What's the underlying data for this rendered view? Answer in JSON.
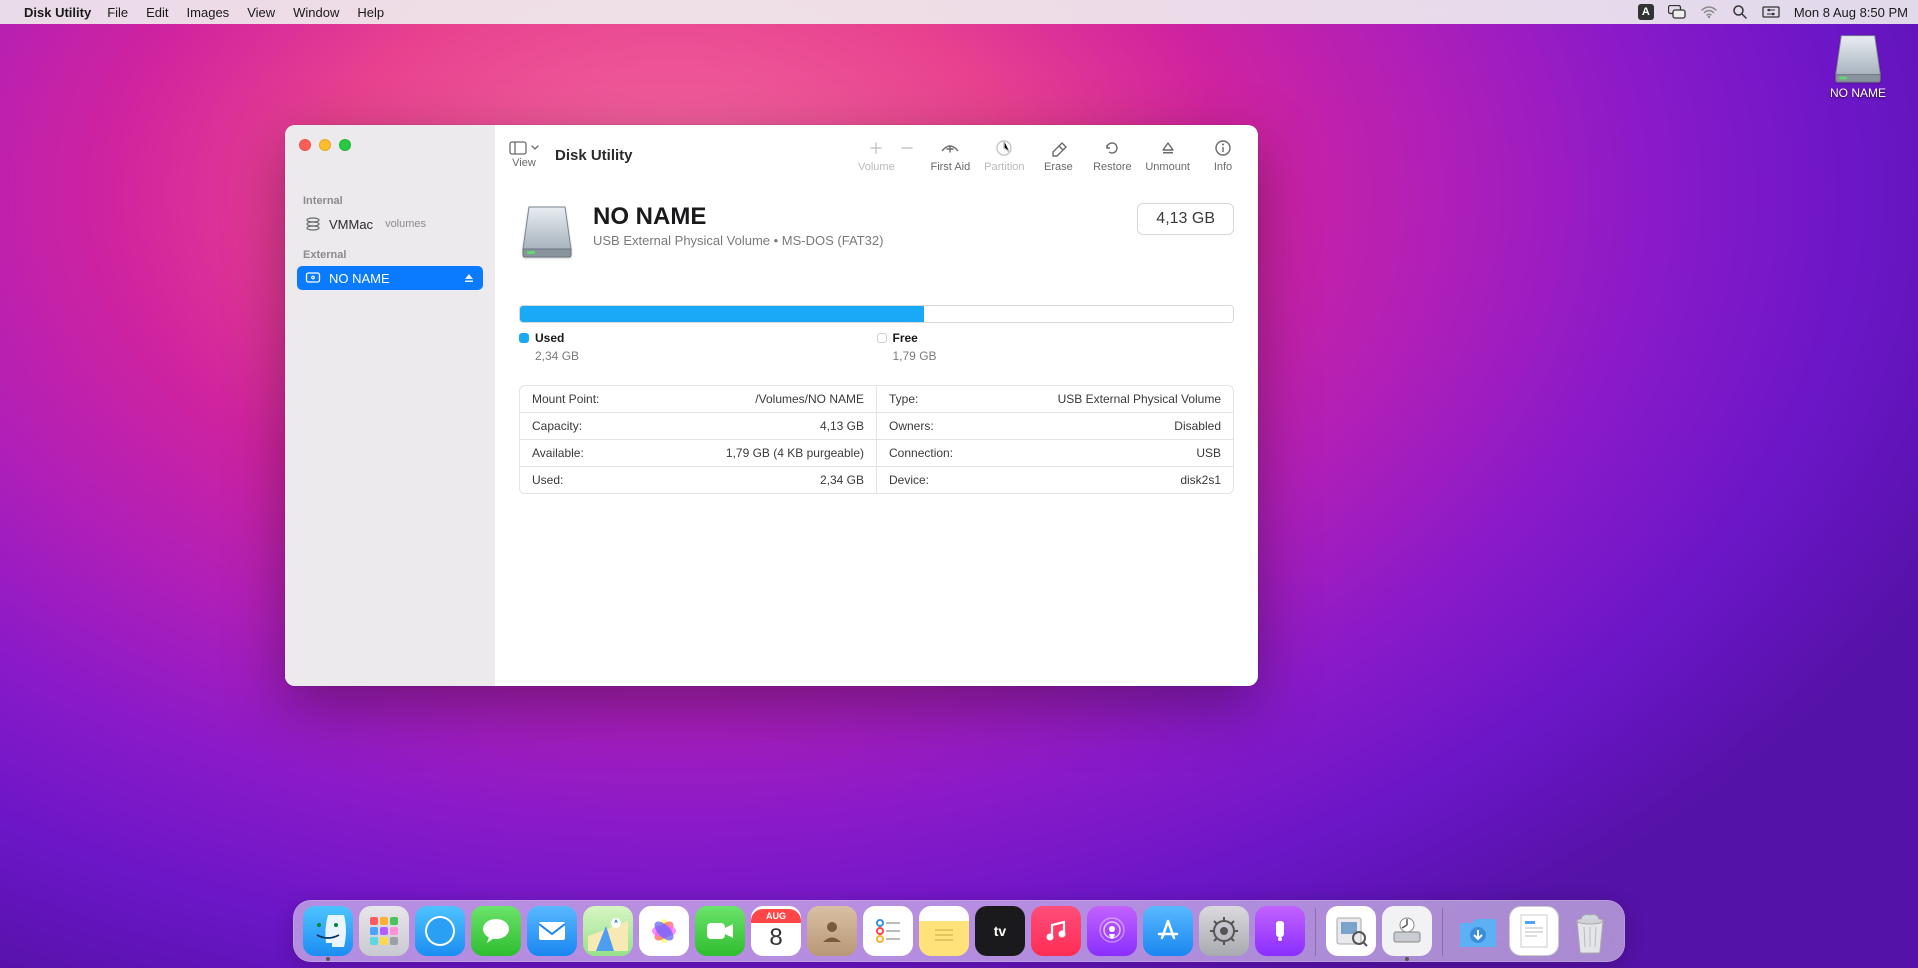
{
  "menubar": {
    "app": "Disk Utility",
    "items": [
      "File",
      "Edit",
      "Images",
      "View",
      "Window",
      "Help"
    ],
    "input_indicator": "A",
    "datetime": "Mon 8 Aug  8:50 PM"
  },
  "desktop": {
    "disk_label": "NO NAME"
  },
  "window": {
    "view_label": "View",
    "title": "Disk Utility",
    "toolbar": {
      "volume": "Volume",
      "first_aid": "First Aid",
      "partition": "Partition",
      "erase": "Erase",
      "restore": "Restore",
      "unmount": "Unmount",
      "info": "Info"
    },
    "sidebar": {
      "internal_heading": "Internal",
      "internal_item": {
        "name": "VMMac",
        "suffix": "volumes"
      },
      "external_heading": "External",
      "external_item": {
        "name": "NO NAME"
      }
    },
    "volume": {
      "name": "NO NAME",
      "subtitle": "USB External Physical Volume • MS-DOS (FAT32)",
      "capacity_badge": "4,13 GB",
      "usage": {
        "used_label": "Used",
        "used_value": "2,34 GB",
        "free_label": "Free",
        "free_value": "1,79 GB",
        "used_pct": 56.7
      },
      "details_left": [
        {
          "k": "Mount Point:",
          "v": "/Volumes/NO NAME"
        },
        {
          "k": "Capacity:",
          "v": "4,13 GB"
        },
        {
          "k": "Available:",
          "v": "1,79 GB (4 KB purgeable)"
        },
        {
          "k": "Used:",
          "v": "2,34 GB"
        }
      ],
      "details_right": [
        {
          "k": "Type:",
          "v": "USB External Physical Volume"
        },
        {
          "k": "Owners:",
          "v": "Disabled"
        },
        {
          "k": "Connection:",
          "v": "USB"
        },
        {
          "k": "Device:",
          "v": "disk2s1"
        }
      ]
    }
  },
  "dock": {
    "apps_left": [
      "finder",
      "launchpad",
      "safari",
      "messages",
      "mail",
      "maps",
      "photos",
      "facetime",
      "calendar",
      "contacts",
      "reminders",
      "notes",
      "tv",
      "music",
      "podcasts",
      "appstore",
      "settings",
      "feedback"
    ],
    "apps_right": [
      "preview",
      "diskutility"
    ],
    "downloads": "downloads",
    "recent_doc": "recent-doc",
    "trash": "trash",
    "calendar_month": "AUG",
    "calendar_day": "8",
    "running": [
      "finder",
      "diskutility"
    ]
  }
}
